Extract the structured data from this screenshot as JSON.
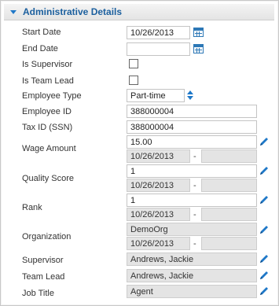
{
  "section": {
    "title": "Administrative Details"
  },
  "fields": {
    "start_date": {
      "label": "Start Date",
      "value": "10/26/2013",
      "icon": "calendar-icon"
    },
    "end_date": {
      "label": "End Date",
      "value": "",
      "icon": "calendar-icon"
    },
    "is_supervisor": {
      "label": "Is Supervisor",
      "checked": false
    },
    "is_team_lead": {
      "label": "Is Team Lead",
      "checked": false
    },
    "employee_type": {
      "label": "Employee Type",
      "value": "Part-time",
      "icon": "spinner-updown-icon"
    },
    "employee_id": {
      "label": "Employee ID",
      "value": "388000004"
    },
    "tax_id": {
      "label": "Tax ID (SSN)",
      "value": "388000004"
    },
    "wage_amount": {
      "label": "Wage Amount",
      "value": "15.00",
      "effective_from": "10/26/2013",
      "separator": "-",
      "effective_to": "",
      "icon": "pencil-icon"
    },
    "quality_score": {
      "label": "Quality Score",
      "value": "1",
      "effective_from": "10/26/2013",
      "separator": "-",
      "effective_to": "",
      "icon": "pencil-icon"
    },
    "rank": {
      "label": "Rank",
      "value": "1",
      "effective_from": "10/26/2013",
      "separator": "-",
      "effective_to": "",
      "icon": "pencil-icon"
    },
    "organization": {
      "label": "Organization",
      "value": "DemoOrg",
      "effective_from": "10/26/2013",
      "separator": "-",
      "effective_to": "",
      "icon": "pencil-icon"
    },
    "supervisor": {
      "label": "Supervisor",
      "value": "Andrews, Jackie",
      "icon": "pencil-icon"
    },
    "team_lead": {
      "label": "Team Lead",
      "value": "Andrews, Jackie",
      "icon": "pencil-icon"
    },
    "job_title": {
      "label": "Job Title",
      "value": "Agent",
      "icon": "pencil-icon"
    }
  },
  "colors": {
    "accent": "#1f78c8",
    "header_text": "#1b5f9e",
    "readonly_bg": "#e4e4e4"
  }
}
